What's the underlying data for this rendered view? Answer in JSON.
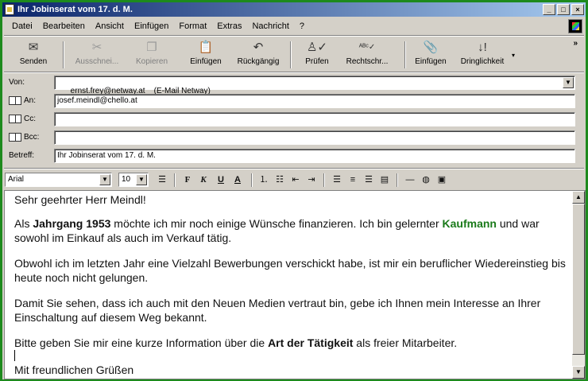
{
  "window": {
    "title": "Ihr Jobinserat vom 17. d. M.",
    "controls": {
      "minimize": "_",
      "maximize": "□",
      "close": "×"
    }
  },
  "menu": {
    "items": [
      {
        "label": "Datei"
      },
      {
        "label": "Bearbeiten"
      },
      {
        "label": "Ansicht"
      },
      {
        "label": "Einfügen"
      },
      {
        "label": "Format"
      },
      {
        "label": "Extras"
      },
      {
        "label": "Nachricht"
      },
      {
        "label": "?"
      }
    ]
  },
  "toolbar": {
    "send": "Senden",
    "cut": "Ausschnei...",
    "copy": "Kopieren",
    "paste": "Einfügen",
    "undo": "Rückgängig",
    "check": "Prüfen",
    "spelling": "Rechtschr...",
    "attach": "Einfügen",
    "priority": "Dringlichkeit",
    "more": "»"
  },
  "header_fields": {
    "from_label": "Von:",
    "from_value": "ernst.frey@netway.at    (E-Mail Netway)",
    "to_label": "An:",
    "to_value": "josef.meindl@chello.at",
    "cc_label": "Cc:",
    "cc_value": "",
    "bcc_label": "Bcc:",
    "bcc_value": "",
    "subject_label": "Betreff:",
    "subject_value": "Ihr Jobinserat vom 17. d. M."
  },
  "format_bar": {
    "font": "Arial",
    "size": "10",
    "bold": "F",
    "italic": "K",
    "underline": "U",
    "color": "A"
  },
  "message": {
    "greeting": "Sehr geehrter Herr Meindl!",
    "p1_a": "Als ",
    "p1_bold": "Jahrgang 1953",
    "p1_b": " möchte ich mir noch einige Wünsche finanzieren. Ich bin gelernter ",
    "p1_green": "Kaufmann",
    "p1_c": " und war sowohl im Einkauf als auch im Verkauf tätig.",
    "p2": "Obwohl ich im letzten Jahr eine Vielzahl Bewerbungen verschickt habe, ist mir ein beruflicher Wiedereinstieg bis heute noch nicht gelungen.",
    "p3": "Damit Sie sehen, dass ich auch mit den Neuen Medien vertraut bin, gebe ich Ihnen mein Interesse an Ihrer Einschaltung auf diesem Weg bekannt.",
    "p4_a": "Bitte geben Sie mir eine kurze Information über die ",
    "p4_bold": "Art der Tätigkeit",
    "p4_b": " als freier Mitarbeiter.",
    "closing": "Mit freundlichen Grüßen"
  },
  "colors": {
    "desktop": "#1d8a1d",
    "titlebar": "#0a246a",
    "highlight_green": "#1a7a1a"
  }
}
